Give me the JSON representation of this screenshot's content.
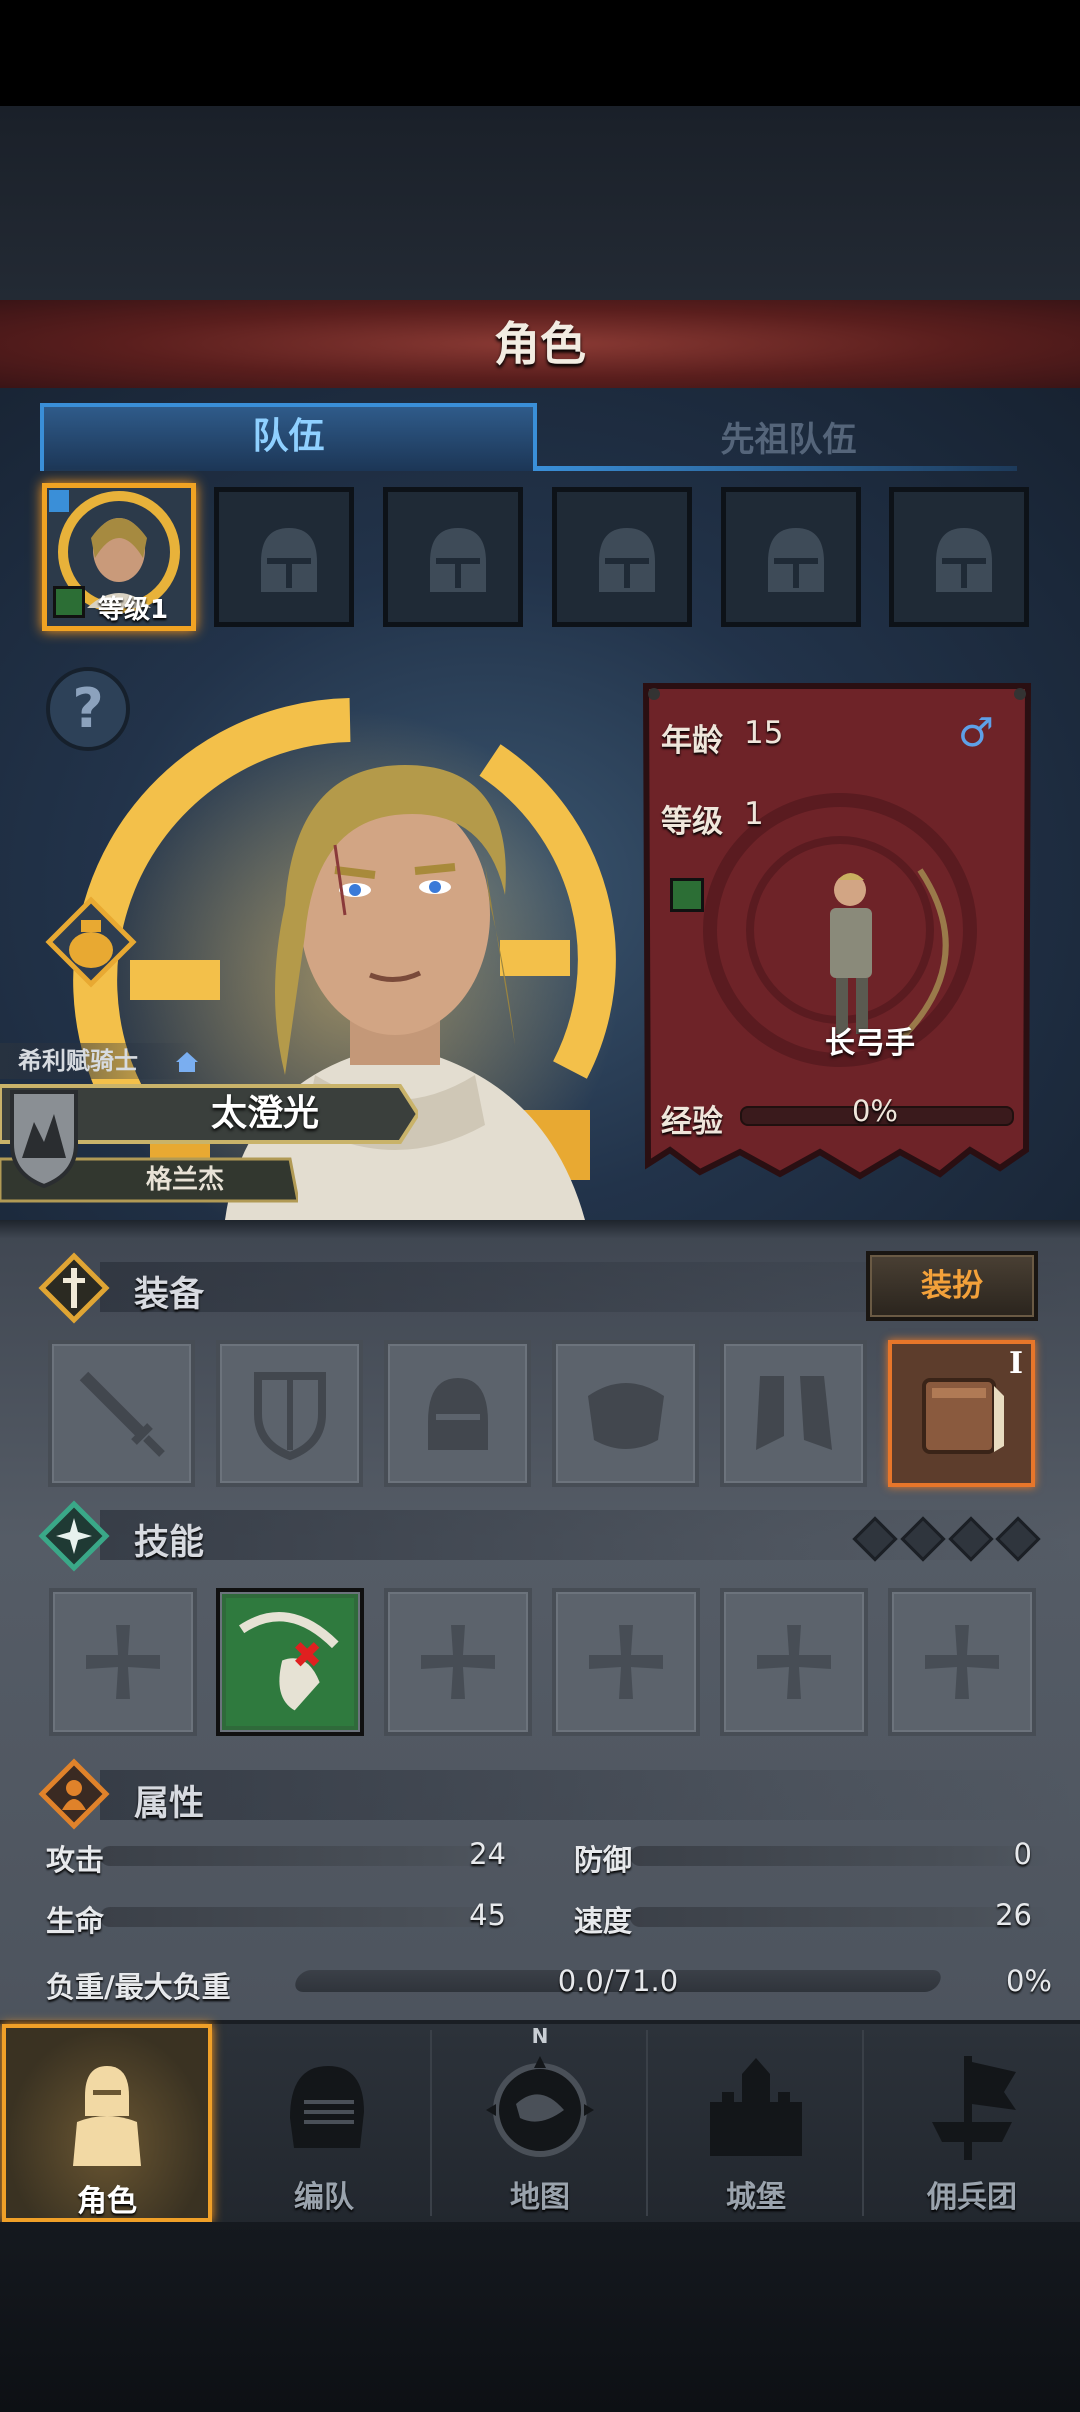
{
  "header": {
    "title": "角色"
  },
  "tabs": [
    {
      "label": "队伍",
      "active": true
    },
    {
      "label": "先祖队伍",
      "active": false
    }
  ],
  "team_slots": {
    "selected_level": "等级1",
    "empty_count": 5
  },
  "hero": {
    "class_title": "希利赋骑士",
    "name": "太澄光",
    "sub_name": "格兰杰",
    "age_label": "年龄",
    "age": "15",
    "level_label": "等级",
    "level": "1",
    "gender_symbol": "♂",
    "unit_class": "长弓手",
    "exp_label": "经验",
    "exp_text": "0%",
    "exp_fraction": 0
  },
  "equipment": {
    "title": "装备",
    "dress_button": "装扮",
    "book_badge": "I",
    "slots": [
      "sword-icon",
      "shield-icon",
      "helmet-icon",
      "armor-icon",
      "boots-icon",
      "book-icon"
    ]
  },
  "skills": {
    "title": "技能",
    "slot_count": 6,
    "points": 4
  },
  "attributes": {
    "title": "属性",
    "attack_label": "攻击",
    "attack": "24",
    "defense_label": "防御",
    "defense": "0",
    "hp_label": "生命",
    "hp": "45",
    "speed_label": "速度",
    "speed": "26",
    "load_label": "负重/最大负重",
    "load": "0.0/71.0",
    "load_pct": "0%"
  },
  "nav": [
    {
      "label": "角色",
      "icon": "knight-icon",
      "active": true
    },
    {
      "label": "编队",
      "icon": "helmet-icon"
    },
    {
      "label": "地图",
      "icon": "compass-icon"
    },
    {
      "label": "城堡",
      "icon": "castle-icon"
    },
    {
      "label": "佣兵团",
      "icon": "banner-icon"
    }
  ],
  "colors": {
    "accent": "#f0a028",
    "tab_active": "#3a8fd8",
    "panel_red": "#6e2328"
  }
}
